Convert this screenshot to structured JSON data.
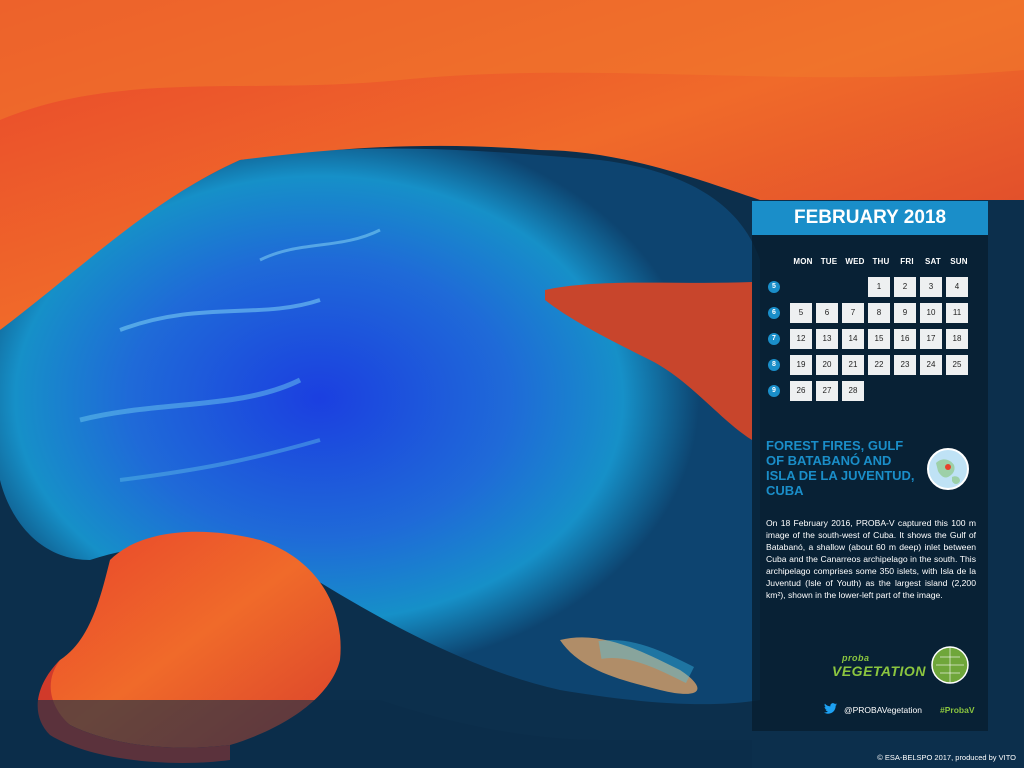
{
  "calendar": {
    "month_title": "FEBRUARY 2018",
    "day_headers": [
      "MON",
      "TUE",
      "WED",
      "THU",
      "FRI",
      "SAT",
      "SUN"
    ],
    "weeks": [
      {
        "number": "5",
        "days": [
          "",
          "",
          "",
          "1",
          "2",
          "3",
          "4"
        ]
      },
      {
        "number": "6",
        "days": [
          "5",
          "6",
          "7",
          "8",
          "9",
          "10",
          "11"
        ]
      },
      {
        "number": "7",
        "days": [
          "12",
          "13",
          "14",
          "15",
          "16",
          "17",
          "18"
        ]
      },
      {
        "number": "8",
        "days": [
          "19",
          "20",
          "21",
          "22",
          "23",
          "24",
          "25"
        ]
      },
      {
        "number": "9",
        "days": [
          "26",
          "27",
          "28",
          "",
          "",
          "",
          ""
        ]
      }
    ]
  },
  "feature": {
    "title": "FOREST FIRES, GULF OF BATABANÓ AND ISLA DE LA JUVENTUD, CUBA",
    "description": "On 18 February 2016, PROBA-V captured this 100 m image of the south-west of Cuba. It shows the Gulf of Batabanó, a shallow (about 60 m deep) inlet between Cuba and the Canarreos archipelago in the south. This archipelago comprises some 350 islets, with Isla de la Juventud (Isle of Youth) as the largest island (2,200 km²), shown in the lower-left part of the image."
  },
  "logo": {
    "small": "proba",
    "big": "VEGETATION"
  },
  "social": {
    "handle": "@PROBAVegetation",
    "hashtag": "#ProbaV"
  },
  "credit": "© ESA-BELSPO 2017, produced by VITO",
  "colors": {
    "accent": "#1a8ec9",
    "brand_green": "#8bc53f",
    "land": "#e8412a",
    "sea_deep": "#0a2a4a",
    "sea_shallow": "#1f5bd6"
  },
  "icons": [
    "globe-icon",
    "twitter-icon"
  ]
}
